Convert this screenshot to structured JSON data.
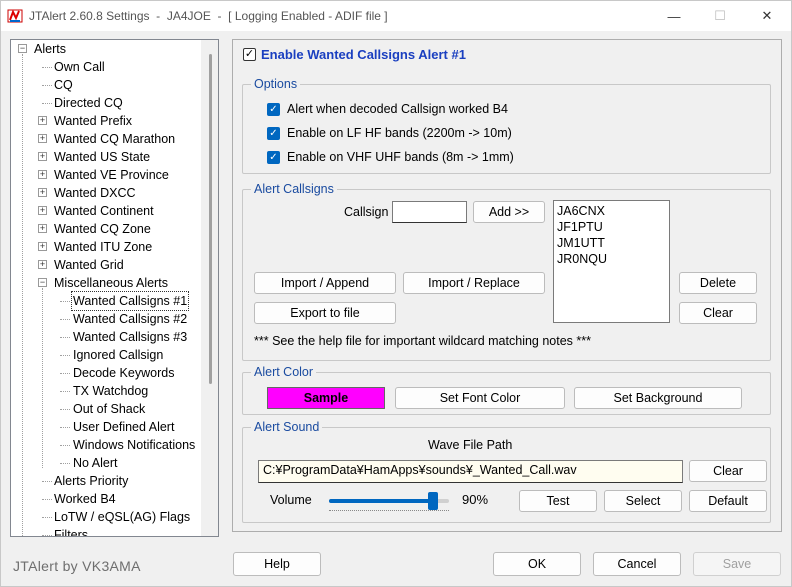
{
  "window": {
    "title": "JTAlert 2.60.8 Settings  -  JA4JOE  -  [ Logging Enabled - ADIF file ]",
    "min_glyph": "—",
    "max_glyph": "☐",
    "close_glyph": "✕"
  },
  "tree": {
    "items": [
      {
        "label": "Alerts",
        "level": 0,
        "expander": "−"
      },
      {
        "label": "Own Call",
        "level": 1,
        "expander": ""
      },
      {
        "label": "CQ",
        "level": 1,
        "expander": ""
      },
      {
        "label": "Directed CQ",
        "level": 1,
        "expander": ""
      },
      {
        "label": "Wanted Prefix",
        "level": 1,
        "expander": "+"
      },
      {
        "label": "Wanted CQ Marathon",
        "level": 1,
        "expander": "+"
      },
      {
        "label": "Wanted US State",
        "level": 1,
        "expander": "+"
      },
      {
        "label": "Wanted VE Province",
        "level": 1,
        "expander": "+"
      },
      {
        "label": "Wanted DXCC",
        "level": 1,
        "expander": "+"
      },
      {
        "label": "Wanted Continent",
        "level": 1,
        "expander": "+"
      },
      {
        "label": "Wanted CQ Zone",
        "level": 1,
        "expander": "+"
      },
      {
        "label": "Wanted ITU Zone",
        "level": 1,
        "expander": "+"
      },
      {
        "label": "Wanted Grid",
        "level": 1,
        "expander": "+"
      },
      {
        "label": "Miscellaneous Alerts",
        "level": 1,
        "expander": "−"
      },
      {
        "label": "Wanted Callsigns #1",
        "level": 2,
        "expander": "",
        "selected": true
      },
      {
        "label": "Wanted Callsigns #2",
        "level": 2,
        "expander": ""
      },
      {
        "label": "Wanted Callsigns #3",
        "level": 2,
        "expander": ""
      },
      {
        "label": "Ignored Callsign",
        "level": 2,
        "expander": ""
      },
      {
        "label": "Decode Keywords",
        "level": 2,
        "expander": ""
      },
      {
        "label": "TX Watchdog",
        "level": 2,
        "expander": ""
      },
      {
        "label": "Out of Shack",
        "level": 2,
        "expander": ""
      },
      {
        "label": "User Defined Alert",
        "level": 2,
        "expander": ""
      },
      {
        "label": "Windows Notifications",
        "level": 2,
        "expander": ""
      },
      {
        "label": "No Alert",
        "level": 2,
        "expander": ""
      },
      {
        "label": "Alerts Priority",
        "level": 1,
        "expander": ""
      },
      {
        "label": "Worked B4",
        "level": 1,
        "expander": ""
      },
      {
        "label": "LoTW / eQSL(AG) Flags",
        "level": 1,
        "expander": ""
      },
      {
        "label": "Filters",
        "level": 1,
        "expander": ""
      }
    ]
  },
  "enable": {
    "label": "Enable Wanted Callsigns Alert #1",
    "checked": true
  },
  "options": {
    "title": "Options",
    "items": [
      {
        "label": "Alert when decoded Callsign worked B4",
        "checked": true
      },
      {
        "label": "Enable on LF  HF bands (2200m -> 10m)",
        "checked": true
      },
      {
        "label": "Enable on VHF  UHF bands (8m -> 1mm)",
        "checked": true
      }
    ]
  },
  "callsigns": {
    "title": "Alert Callsigns",
    "callsign_label": "Callsign",
    "callsign_value": "",
    "add_label": "Add >>",
    "import_append_label": "Import / Append",
    "import_replace_label": "Import / Replace",
    "export_label": "Export to file",
    "delete_label": "Delete",
    "clear_label": "Clear",
    "list": [
      "JA6CNX",
      "JF1PTU",
      "JM1UTT",
      "JR0NQU"
    ],
    "note": "***  See the help file for important wildcard matching notes  ***"
  },
  "color": {
    "title": "Alert Color",
    "sample_label": "Sample",
    "sample_bg": "#ff00ff",
    "font_color_label": "Set Font Color",
    "background_label": "Set Background"
  },
  "sound": {
    "title": "Alert Sound",
    "path_label": "Wave File Path",
    "path_value": "C:¥ProgramData¥HamApps¥sounds¥_Wanted_Call.wav",
    "clear_label": "Clear",
    "volume_label": "Volume",
    "volume_value": 0.9,
    "volume_text": "90%",
    "test_label": "Test",
    "select_label": "Select",
    "default_label": "Default"
  },
  "footer": {
    "brand": "JTAlert by VK3AMA",
    "help_label": "Help",
    "ok_label": "OK",
    "cancel_label": "Cancel",
    "save_label": "Save"
  },
  "colors": {
    "accent": "#0067c0",
    "group_title": "#1a4ba0"
  }
}
